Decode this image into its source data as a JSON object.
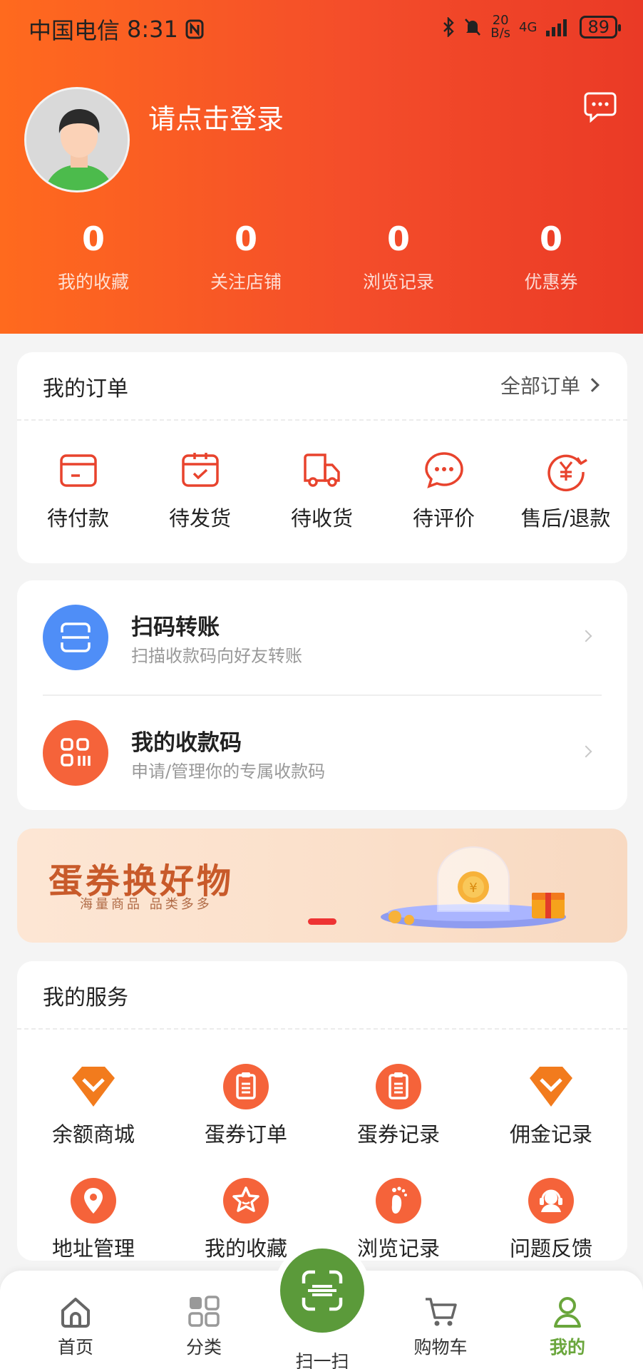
{
  "status_bar": {
    "carrier": "中国电信",
    "time": "8:31",
    "speed_top": "20",
    "speed_bottom": "B/s",
    "network": "4G",
    "battery": "89"
  },
  "profile": {
    "login_text": "请点击登录"
  },
  "stats": [
    {
      "value": "0",
      "label": "我的收藏"
    },
    {
      "value": "0",
      "label": "关注店铺"
    },
    {
      "value": "0",
      "label": "浏览记录"
    },
    {
      "value": "0",
      "label": "优惠券"
    }
  ],
  "orders": {
    "title": "我的订单",
    "all_label": "全部订单",
    "items": [
      {
        "label": "待付款",
        "icon": "wallet-icon"
      },
      {
        "label": "待发货",
        "icon": "box-check-icon"
      },
      {
        "label": "待收货",
        "icon": "truck-icon"
      },
      {
        "label": "待评价",
        "icon": "chat-bubble-icon"
      },
      {
        "label": "售后/退款",
        "icon": "yuan-refund-icon"
      }
    ]
  },
  "payments": [
    {
      "title": "扫码转账",
      "subtitle": "扫描收款码向好友转账",
      "icon": "scan-icon",
      "color": "#4f8ef7"
    },
    {
      "title": "我的收款码",
      "subtitle": "申请/管理你的专属收款码",
      "icon": "qrcode-icon",
      "color": "#f5633a"
    }
  ],
  "banner": {
    "headline": "蛋券换好物",
    "tagline": "海量商品  品类多多"
  },
  "services": {
    "title": "我的服务",
    "items": [
      {
        "label": "余额商城",
        "icon": "diamond-icon"
      },
      {
        "label": "蛋券订单",
        "icon": "clipboard-icon"
      },
      {
        "label": "蛋券记录",
        "icon": "clipboard-icon"
      },
      {
        "label": "佣金记录",
        "icon": "diamond-icon"
      },
      {
        "label": "地址管理",
        "icon": "location-icon"
      },
      {
        "label": "我的收藏",
        "icon": "star-icon"
      },
      {
        "label": "浏览记录",
        "icon": "footprint-icon"
      },
      {
        "label": "问题反馈",
        "icon": "support-icon"
      }
    ]
  },
  "tabbar": {
    "home": "首页",
    "category": "分类",
    "scan": "扫一扫",
    "cart": "购物车",
    "mine": "我的"
  },
  "colors": {
    "header_start": "#ff6a1e",
    "header_end": "#ea3a26",
    "accent": "#f5633a",
    "active_tab": "#6aa63c"
  }
}
